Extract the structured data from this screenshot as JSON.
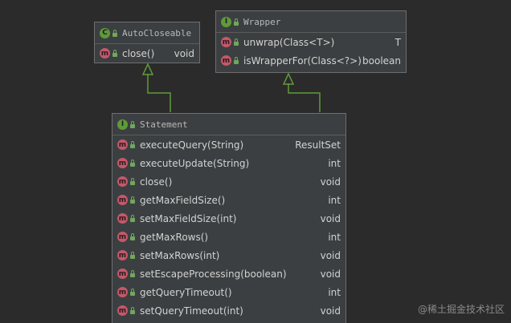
{
  "autocloseable": {
    "name": "AutoCloseable",
    "class_icon": "C",
    "methods": [
      {
        "name": "close()",
        "type": "void",
        "icon": "m"
      }
    ]
  },
  "wrapper": {
    "name": "Wrapper",
    "class_icon": "I",
    "methods": [
      {
        "name": "unwrap(Class<T>)",
        "type": "T",
        "icon": "m"
      },
      {
        "name": "isWrapperFor(Class<?>)",
        "type": "boolean",
        "icon": "m"
      }
    ]
  },
  "statement": {
    "name": "Statement",
    "class_icon": "I",
    "methods": [
      {
        "name": "executeQuery(String)",
        "type": "ResultSet",
        "icon": "m"
      },
      {
        "name": "executeUpdate(String)",
        "type": "int",
        "icon": "m"
      },
      {
        "name": "close()",
        "type": "void",
        "icon": "m"
      },
      {
        "name": "getMaxFieldSize()",
        "type": "int",
        "icon": "m"
      },
      {
        "name": "setMaxFieldSize(int)",
        "type": "void",
        "icon": "m"
      },
      {
        "name": "getMaxRows()",
        "type": "int",
        "icon": "m"
      },
      {
        "name": "setMaxRows(int)",
        "type": "void",
        "icon": "m"
      },
      {
        "name": "setEscapeProcessing(boolean)",
        "type": "void",
        "icon": "m"
      },
      {
        "name": "getQueryTimeout()",
        "type": "int",
        "icon": "m"
      },
      {
        "name": "setQueryTimeout(int)",
        "type": "void",
        "icon": "m"
      }
    ]
  },
  "watermark": "@稀土掘金技术社区",
  "colors": {
    "background": "#2b2b2b",
    "box": "#3c3f41",
    "arrow": "#5f9a3a",
    "method_icon": "#c4586a",
    "class_icon": "#5f9a3a"
  }
}
